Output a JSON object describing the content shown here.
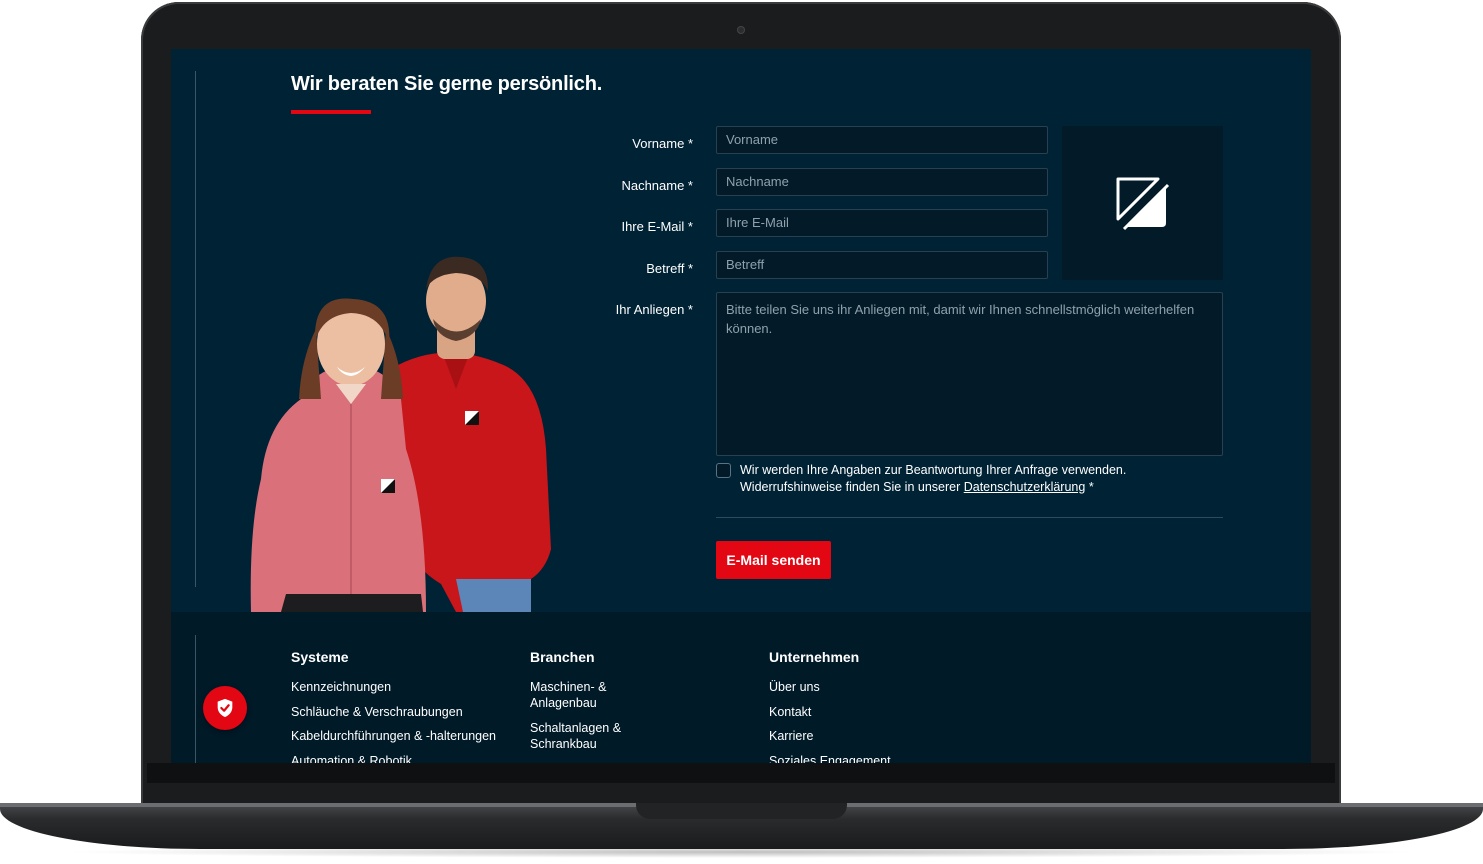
{
  "section": {
    "heading": "Wir beraten Sie gerne persönlich."
  },
  "form": {
    "firstname": {
      "label": "Vorname *",
      "placeholder": "Vorname"
    },
    "lastname": {
      "label": "Nachname *",
      "placeholder": "Nachname"
    },
    "email": {
      "label": "Ihre E-Mail *",
      "placeholder": "Ihre E-Mail"
    },
    "subject": {
      "label": "Betreff *",
      "placeholder": "Betreff"
    },
    "message": {
      "label": "Ihr Anliegen *",
      "placeholder": "Bitte teilen Sie uns ihr Anliegen mit, damit wir Ihnen schnellstmöglich weiterhelfen können."
    },
    "consent": {
      "text_line1": "Wir werden Ihre Angaben zur Beantwortung Ihrer Anfrage verwenden.",
      "text_line2": "Widerrufshinweise finden Sie in unserer",
      "link": "Datenschutzerklärung",
      "required_mark": "*",
      "checked": false
    },
    "submit_label": "E-Mail senden"
  },
  "footer": {
    "columns": [
      {
        "title": "Systeme",
        "items": [
          "Kennzeichnungen",
          "Schläuche & Verschraubungen",
          "Kabeldurchführungen & -halterungen",
          "Automation & Robotik"
        ]
      },
      {
        "title": "Branchen",
        "items": [
          "Maschinen- & Anlagenbau",
          "Schaltanlagen & Schrankbau"
        ]
      },
      {
        "title": "Unternehmen",
        "items": [
          "Über uns",
          "Kontakt",
          "Karriere",
          "Soziales Engagement"
        ]
      }
    ]
  },
  "icons": {
    "brand_logo": "brand-logo-icon",
    "privacy_button": "shield-check-icon"
  },
  "colors": {
    "background": "#002235",
    "field_background": "#031b28",
    "accent": "#e30613",
    "footer_background": "#001a28"
  }
}
